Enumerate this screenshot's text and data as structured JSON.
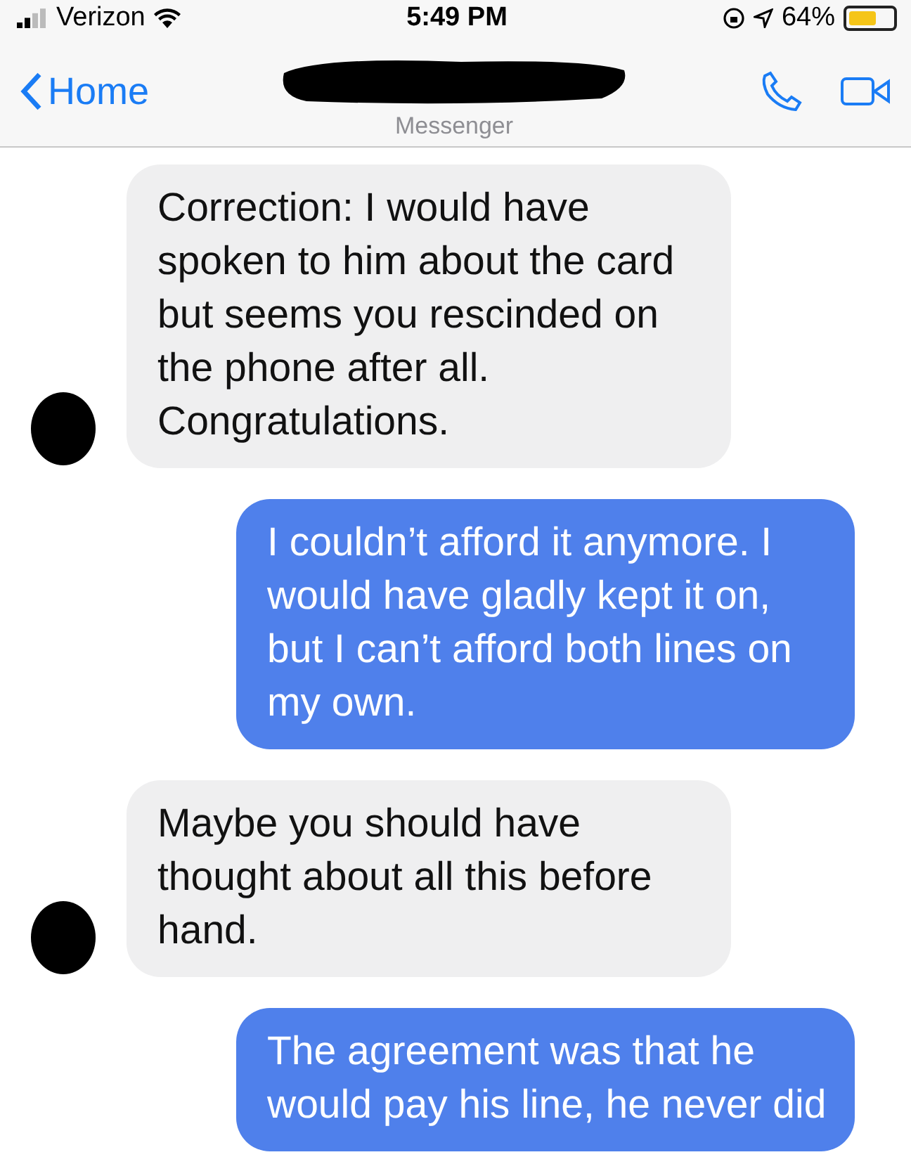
{
  "status_bar": {
    "carrier": "Verizon",
    "time": "5:49 PM",
    "battery": "64%"
  },
  "nav": {
    "back": "Home",
    "subtitle": "Messenger"
  },
  "messages": [
    {
      "kind": "received",
      "text": "Correction: I would have spoken to him about the card but seems you rescinded on the phone after all. Congratulations."
    },
    {
      "kind": "sent",
      "text": "I couldn’t afford it anymore. I would have gladly kept it on, but I can’t afford both lines on my own."
    },
    {
      "kind": "received",
      "text": "Maybe you should have thought about all this before hand."
    },
    {
      "kind": "sent",
      "text": "The agreement was that he would pay his line, he never did"
    }
  ]
}
